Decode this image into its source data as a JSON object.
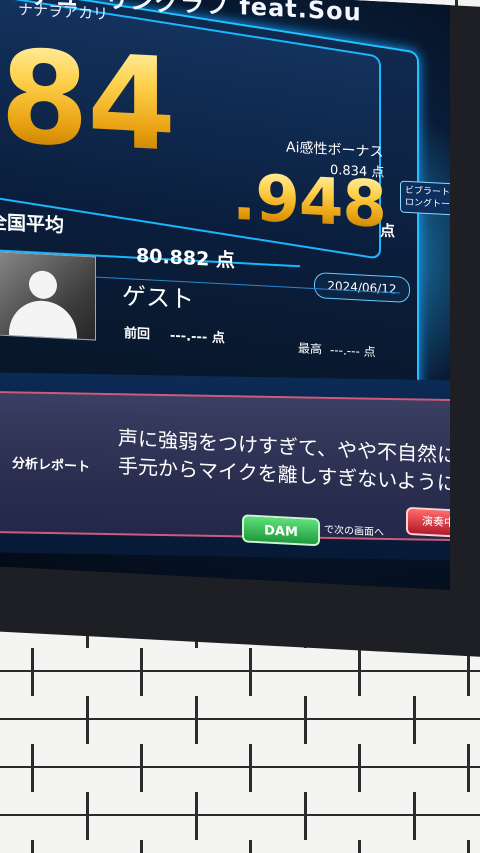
{
  "song": {
    "title": "デューリングラブ feat.Sou",
    "artist": "ナナヲアカリ"
  },
  "score": {
    "major": "84",
    "minor": ".948",
    "unit": "点"
  },
  "bonus": {
    "label": "Ai感性ボーナス",
    "value": "0.834 点"
  },
  "side_tag": {
    "line1": "ビブラート&",
    "line2": "ロングトーン"
  },
  "national_average": {
    "label": "全国平均",
    "value": "80.882 点"
  },
  "date": "2024/06/12",
  "user": {
    "name": "ゲスト",
    "previous_label": "前回",
    "previous_value": "---.--- 点",
    "best_label": "最高",
    "best_value": "---.--- 点"
  },
  "report": {
    "label": "分析レポート",
    "line1": "声に強弱をつけすぎて、やや不自然に聴こ",
    "line2": "手元からマイクを離しすぎないように。"
  },
  "buttons": {
    "dam": "DAM",
    "next": "で次の画面へ",
    "red": "演奏中"
  },
  "bezel_text": "",
  "colors": {
    "score_gold": "#ffc12b",
    "panel_border": "#1fc3ff",
    "report_border": "#d05a78",
    "dam_green": "#2fbf55",
    "red_button": "#d22a3a"
  }
}
